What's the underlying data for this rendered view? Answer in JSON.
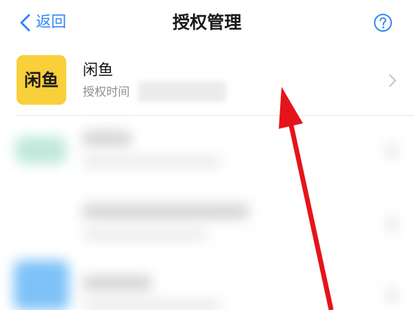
{
  "nav": {
    "back_label": "返回",
    "title": "授权管理",
    "help_icon": "help-circle-icon"
  },
  "authorized_apps": [
    {
      "name": "闲鱼",
      "subtitle": "授权时间",
      "icon_text": "闲鱼",
      "icon_color": "#f9cf3a"
    }
  ],
  "colors": {
    "accent": "#2f86f6",
    "annotation_arrow": "#e5141b"
  }
}
